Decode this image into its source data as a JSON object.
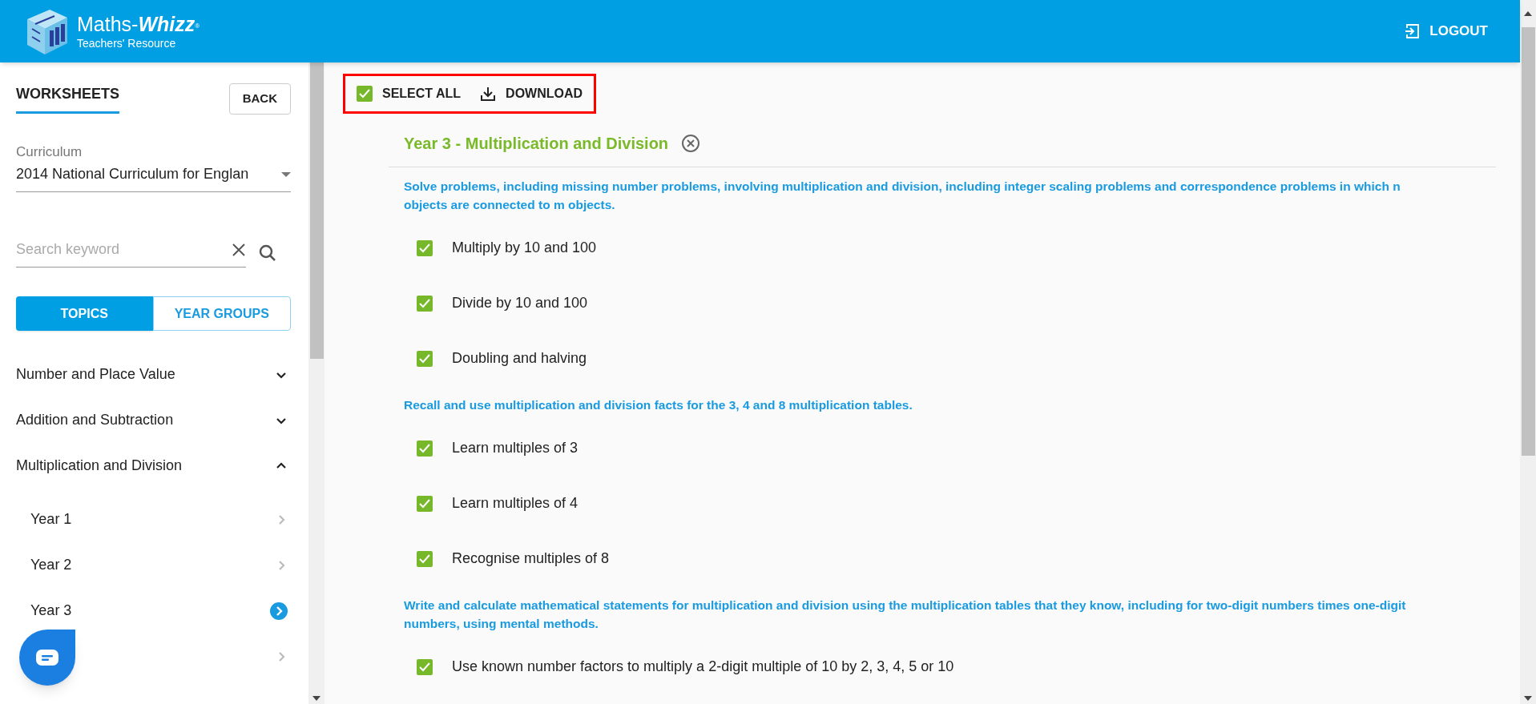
{
  "header": {
    "brand": "Maths-",
    "brand_bold": "Whizz",
    "brand_mark": "®",
    "subtitle": "Teachers' Resource",
    "logout": "LOGOUT"
  },
  "sidebar": {
    "title": "WORKSHEETS",
    "back": "BACK",
    "curriculum_label": "Curriculum",
    "curriculum_value": "2014 National Curriculum for Englan",
    "search_placeholder": "Search keyword",
    "tabs": [
      {
        "label": "TOPICS",
        "selected": true
      },
      {
        "label": "YEAR GROUPS",
        "selected": false
      }
    ],
    "topics": [
      {
        "label": "Number and Place Value",
        "expanded": false
      },
      {
        "label": "Addition and Subtraction",
        "expanded": false
      },
      {
        "label": "Multiplication and Division",
        "expanded": true,
        "children": [
          {
            "label": "Year 1",
            "selected": false
          },
          {
            "label": "Year 2",
            "selected": false
          },
          {
            "label": "Year 3",
            "selected": true
          },
          {
            "selected": false
          }
        ]
      }
    ]
  },
  "toolbar": {
    "select_all": "SELECT ALL",
    "select_all_checked": true,
    "download": "DOWNLOAD"
  },
  "section": {
    "title": "Year 3 - Multiplication and Division",
    "objectives": [
      {
        "text": "Solve problems, including missing number problems, involving multiplication and division, including integer scaling problems and correspondence problems in which n objects are connected to m objects.",
        "items": [
          {
            "label": "Multiply by 10 and 100",
            "checked": true
          },
          {
            "label": "Divide by 10 and 100",
            "checked": true
          },
          {
            "label": "Doubling and halving",
            "checked": true
          }
        ]
      },
      {
        "text": "Recall and use multiplication and division facts for the 3, 4 and 8 multiplication tables.",
        "items": [
          {
            "label": "Learn multiples of 3",
            "checked": true
          },
          {
            "label": "Learn multiples of 4",
            "checked": true
          },
          {
            "label": "Recognise multiples of 8",
            "checked": true
          }
        ]
      },
      {
        "text": "Write and calculate mathematical statements for multiplication and division using the multiplication tables that they know, including for two-digit numbers times one-digit numbers, using mental methods.",
        "items": [
          {
            "label": "Use known number factors to multiply a 2-digit multiple of 10 by 2, 3, 4, 5 or 10",
            "checked": true
          }
        ]
      }
    ]
  }
}
